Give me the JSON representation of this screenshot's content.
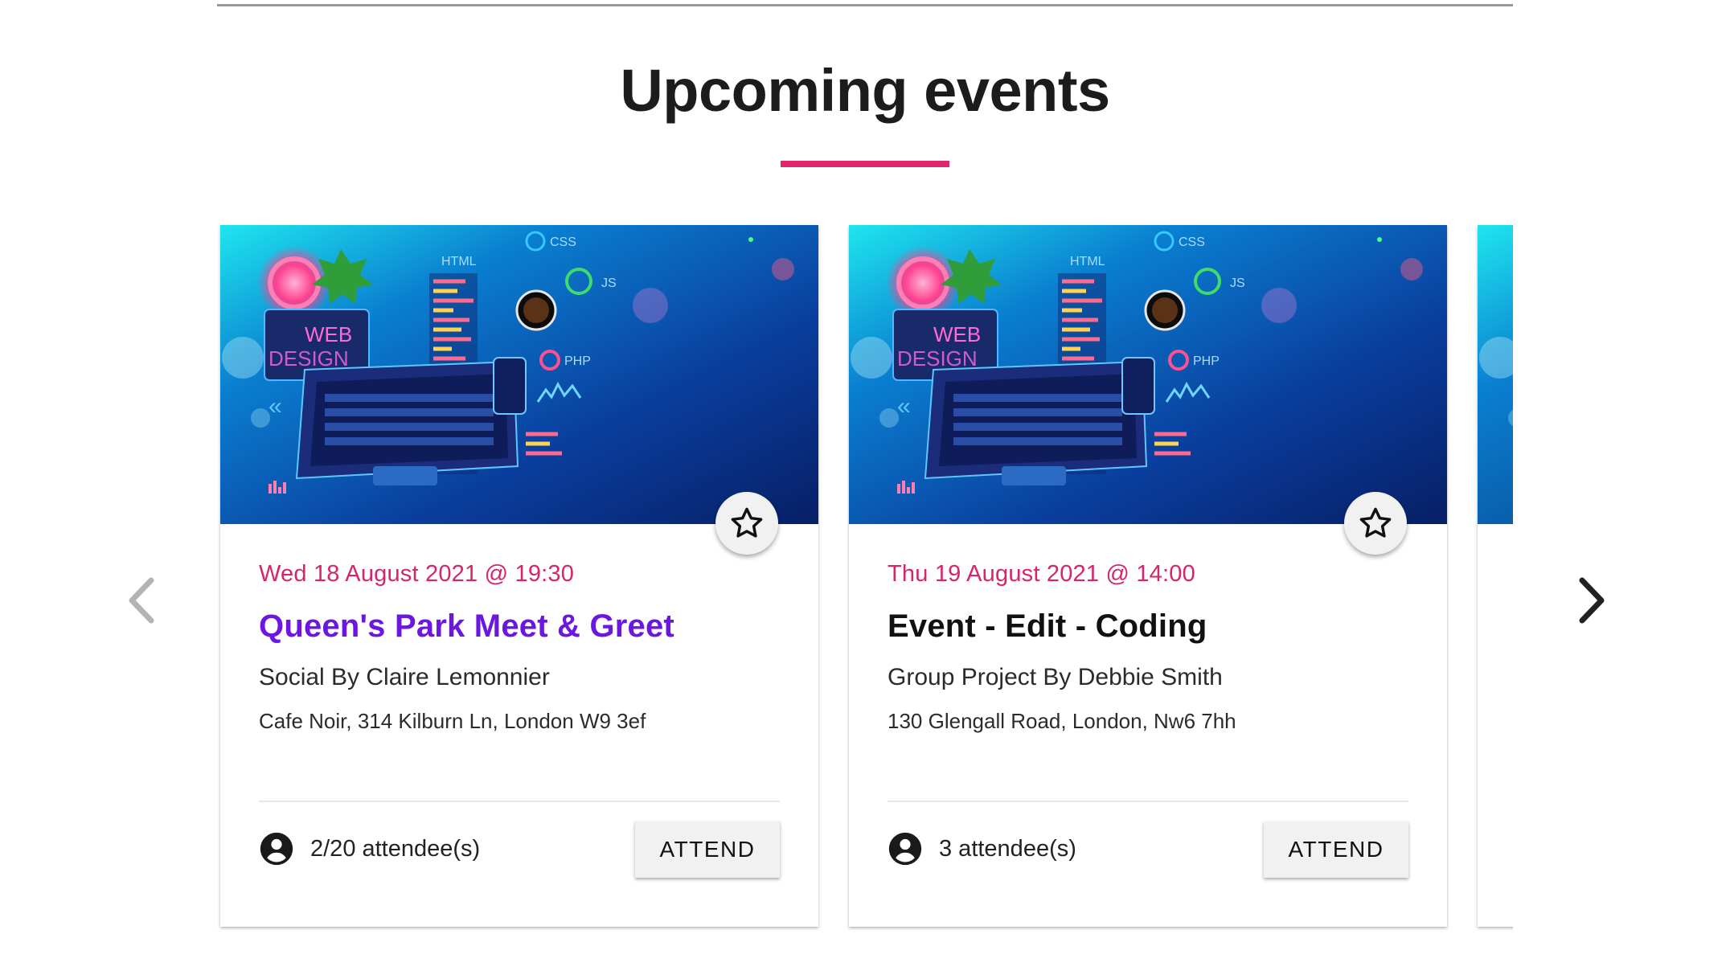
{
  "section": {
    "title": "Upcoming events",
    "accent_color": "#e0266c"
  },
  "carousel": {
    "prev_icon": "chevron-left-icon",
    "next_icon": "chevron-right-icon"
  },
  "events": [
    {
      "date": "Wed 18 August 2021 @ 19:30",
      "title": "Queen's Park Meet & Greet",
      "meta": "Social By Claire Lemonnier",
      "address": "Cafe Noir, 314 Kilburn Ln, London W9 3ef",
      "attendees": "2/20 attendee(s)",
      "attend_label": "ATTEND",
      "title_color": "#6b17e0"
    },
    {
      "date": "Thu 19 August 2021 @ 14:00",
      "title": "Event - Edit - Coding",
      "meta": "Group Project By Debbie Smith",
      "address": "130 Glengall Road, London, Nw6 7hh",
      "attendees": "3 attendee(s)",
      "attend_label": "ATTEND",
      "title_color": "#111111"
    }
  ],
  "image_labels": {
    "html": "HTML",
    "css": "CSS",
    "js": "JS",
    "php": "PHP",
    "web": "WEB",
    "design": "DESIGN"
  }
}
